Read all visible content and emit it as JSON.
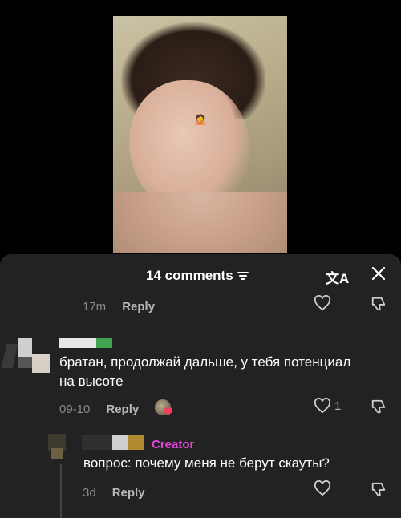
{
  "header": {
    "title": "14 comments",
    "filter_icon": "filter-icon",
    "translate_glyph": "文A",
    "close_icon": "close-icon"
  },
  "comments": [
    {
      "time": "17m",
      "reply_label": "Reply"
    },
    {
      "text_line1": "братан, продолжай дальше, у тебя потенциал",
      "text_line2": "на высоте",
      "time": "09-10",
      "reply_label": "Reply",
      "like_count": "1"
    },
    {
      "creator_label": "Creator",
      "text": "вопрос: почему меня не берут скауты?",
      "time": "3d",
      "reply_label": "Reply"
    }
  ],
  "colors": {
    "sheet_bg": "#222222",
    "creator_accent": "#e14ad8",
    "muted_text": "#8a8a8a"
  }
}
